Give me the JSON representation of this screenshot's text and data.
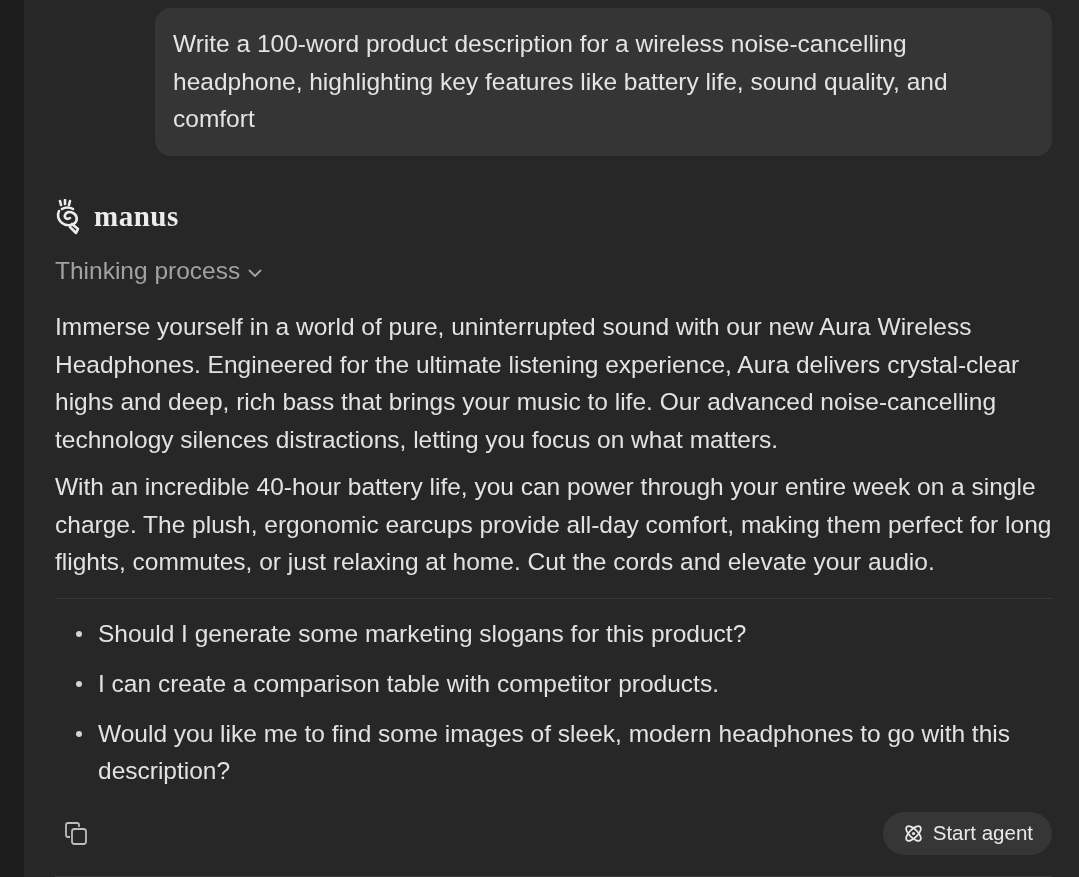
{
  "user_message": {
    "text": "Write a 100-word product description for a wireless noise-cancelling headphone, highlighting key features like battery life, sound quality, and comfort"
  },
  "assistant": {
    "name": "manus",
    "thinking": {
      "label": "Thinking process",
      "expanded": false
    },
    "paragraphs": [
      "Immerse yourself in a world of pure, uninterrupted sound with our new Aura Wireless Headphones. Engineered for the ultimate listening experience, Aura delivers crystal-clear highs and deep, rich bass that brings your music to life. Our advanced noise-cancelling technology silences distractions, letting you focus on what matters.",
      "With an incredible 40-hour battery life, you can power through your entire week on a single charge. The plush, ergonomic earcups provide all-day comfort, making them perfect for long flights, commutes, or just relaxing at home. Cut the cords and elevate your audio."
    ],
    "suggestions": [
      "Should I generate some marketing slogans for this product?",
      "I can create a comparison table with competitor products.",
      "Would you like me to find some images of sleek, modern headphones to go with this description?"
    ],
    "start_agent": {
      "label": "Start agent"
    }
  }
}
